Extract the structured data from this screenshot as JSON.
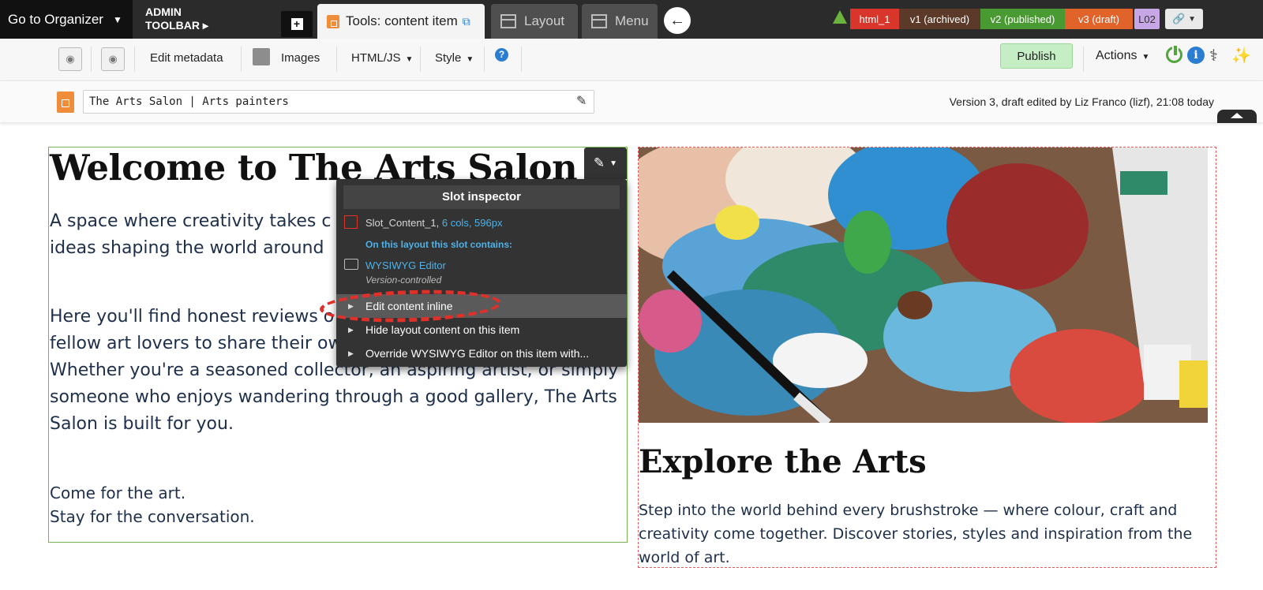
{
  "topbar": {
    "organizer_label": "Go to Organizer",
    "admin_toolbar_line1": "ADMIN",
    "admin_toolbar_line2": "TOOLBAR ▸",
    "tools_tab_label": "Tools: content item",
    "layout_tab_label": "Layout",
    "menu_tab_label": "Menu",
    "versions": {
      "html": "html_1",
      "v1": "v1 (archived)",
      "v2": "v2 (published)",
      "v3": "v3 (draft)",
      "layout_code": "L02"
    },
    "colors": {
      "html": "#d9362b",
      "archived": "#5b3a29",
      "published": "#4a9a33",
      "draft": "#e0632a"
    }
  },
  "toolbar": {
    "edit_metadata": "Edit metadata",
    "images": "Images",
    "html_js": "HTML/JS",
    "style": "Style",
    "publish": "Publish",
    "actions": "Actions"
  },
  "titlerow": {
    "title_value": "The Arts Salon | Arts painters",
    "version_info": "Version 3, draft edited by Liz Franco (lizf), 21:08 today"
  },
  "content": {
    "heading": "Welcome to The Arts Salon",
    "para1": "A space where creativity takes c art to thought-provoking culture ideas shaping the world around",
    "para2": "Here you'll find honest reviews o a calendar of cultural events wo fellow art lovers to share their own work and get involved. Whether you're a seasoned collector, an aspiring artist, or simply someone who enjoys wandering through a good gallery, The Arts Salon is built for you.",
    "para3_line1": "Come for the art.",
    "para3_line2": "Stay for the conversation.",
    "explore_heading": "Explore the Arts",
    "explore_para": "Step into the world behind every brushstroke — where colour, craft and creativity come together. Discover stories, styles and inspiration from the world of art."
  },
  "inspector": {
    "title": "Slot inspector",
    "slot_name": "Slot_Content_1,",
    "slot_dims": "6 cols, 596px",
    "contains_label": "On this layout this slot contains:",
    "module_name": "WYSIWYG Editor",
    "module_note": "Version-controlled",
    "items": [
      "Edit content inline",
      "Hide layout content on this item",
      "Override WYSIWYG Editor on this item with..."
    ]
  }
}
